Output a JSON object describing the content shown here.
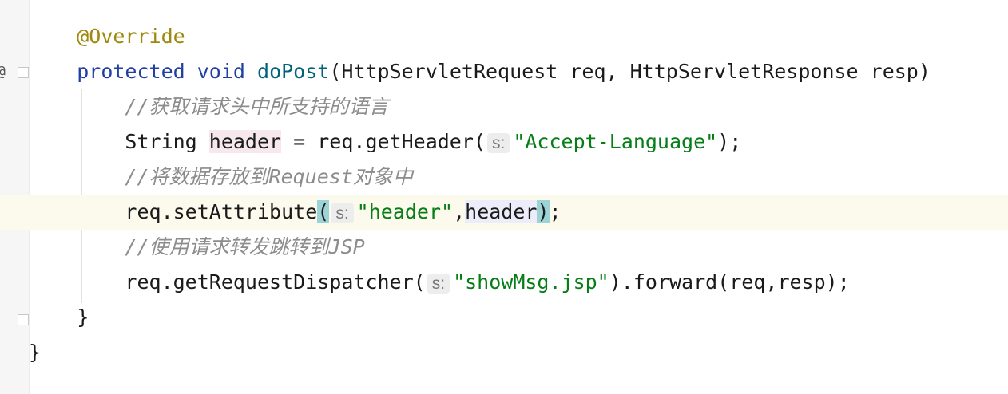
{
  "editor": {
    "lines": {
      "l1": {
        "annotation": "@Override"
      },
      "l2": {
        "kw1": "protected",
        "kw2": "void",
        "method": "doPost",
        "params": "(HttpServletRequest req, HttpServletResponse resp)"
      },
      "l3": {
        "comment": "//获取请求头中所支持的语言"
      },
      "l4": {
        "a": "String ",
        "var": "header",
        "b": " = req.getHeader(",
        "hint": "s:",
        "str": "\"Accept-Language\"",
        "c": ");"
      },
      "l5": {
        "comment": "//将数据存放到Request对象中"
      },
      "l6": {
        "a": "req.setAttribute",
        "open": "(",
        "hint": "s:",
        "str": "\"header\"",
        "comma": ",",
        "var": "header",
        "close": ")",
        "end": ";"
      },
      "l7": {
        "comment": "//使用请求转发跳转到JSP"
      },
      "l8": {
        "a": "req.getRequestDispatcher(",
        "hint": "s:",
        "str": "\"showMsg.jsp\"",
        "b": ").forward(req,resp);"
      },
      "l9": {
        "text": "}"
      },
      "l10": {
        "text": "}"
      }
    },
    "gutter": {
      "override_marker": "@",
      "bulb": "intention-bulb"
    }
  },
  "colors": {
    "keyword": "#1f3fa3",
    "annotation": "#9e880d",
    "method": "#00627a",
    "string": "#067d17",
    "comment": "#8c8c8c",
    "current_line": "#fcfaed"
  }
}
